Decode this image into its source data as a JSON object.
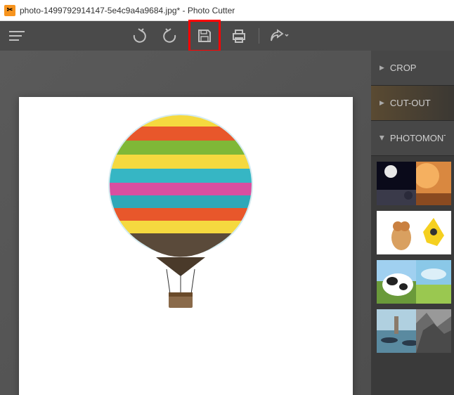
{
  "titlebar": {
    "text": "photo-1499792914147-5e4c9a4a9684.jpg* - Photo Cutter"
  },
  "toolbar": {
    "menu": "menu",
    "undo": "undo",
    "redo": "redo",
    "save": "save",
    "print": "print",
    "share": "share"
  },
  "sidebar": {
    "panels": [
      {
        "label": "CROP",
        "expanded": false
      },
      {
        "label": "CUT-OUT",
        "expanded": false
      },
      {
        "label": "PHOTOMONTAGE",
        "expanded": true
      }
    ]
  },
  "canvas": {
    "subject": "hot-air-balloon"
  },
  "thumbnails": [
    {
      "name": "moon"
    },
    {
      "name": "planet"
    },
    {
      "name": "cat"
    },
    {
      "name": "splash"
    },
    {
      "name": "cow"
    },
    {
      "name": "field"
    },
    {
      "name": "venice"
    },
    {
      "name": "rock"
    }
  ]
}
